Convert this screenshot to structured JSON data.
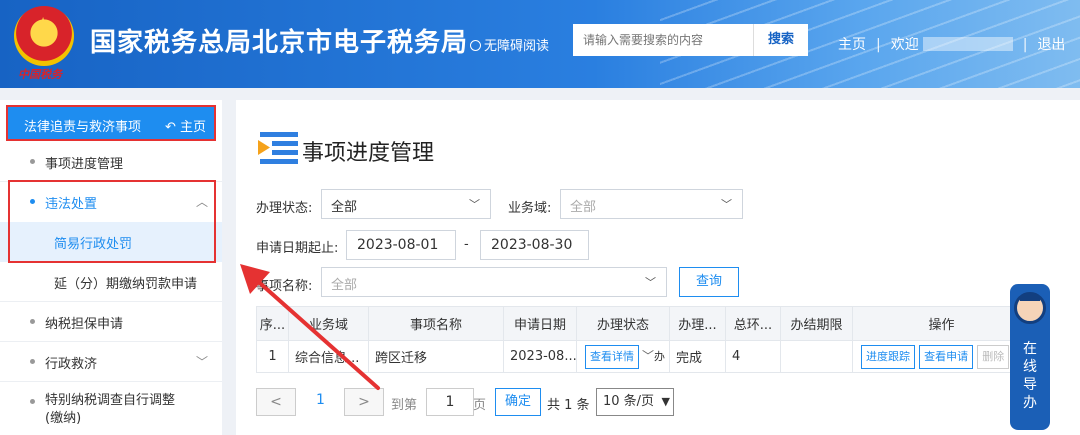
{
  "header": {
    "emblem_caption": "中国税务",
    "site_title": "国家税务总局北京市电子税务局",
    "accessibility": "无障碍阅读",
    "search_placeholder": "请输入需要搜索的内容",
    "search_button": "搜索",
    "nav_home": "主页",
    "nav_welcome": "欢迎",
    "nav_logout": "退出"
  },
  "sidebar": {
    "section_title": "法律追责与救济事项",
    "home_link": "主页",
    "items": [
      {
        "label": "事项进度管理"
      },
      {
        "label": "违法处置"
      },
      {
        "label": "简易行政处罚"
      },
      {
        "label": "延（分）期缴纳罚款申请"
      },
      {
        "label": "纳税担保申请"
      },
      {
        "label": "行政救济"
      },
      {
        "label": "特别纳税调查自行调整"
      },
      {
        "label": "(缴纳)"
      }
    ]
  },
  "main": {
    "title": "事项进度管理",
    "filters": {
      "status_label": "办理状态:",
      "status_value": "全部",
      "domain_label": "业务域:",
      "domain_placeholder": "全部",
      "date_label": "申请日期起止:",
      "date_from": "2023-08-01",
      "date_sep": "-",
      "date_to": "2023-08-30",
      "item_label": "事项名称:",
      "item_placeholder": "全部",
      "query_button": "查询"
    },
    "table": {
      "headers": [
        "序...",
        "业务域",
        "事项名称",
        "申请日期",
        "办理状态",
        "办理...",
        "总环...",
        "办结期限",
        "操作"
      ],
      "rows": [
        {
          "index": "1",
          "domain": "综合信息...",
          "name": "跨区迁移",
          "date": "2023-08...",
          "status_btn": "查看详情",
          "status_suffix": "办",
          "result": "完成",
          "total": "4",
          "deadline": "",
          "op_track": "进度跟踪",
          "op_view": "查看申请",
          "op_delete": "删除"
        }
      ]
    },
    "pagination": {
      "prev": "<",
      "current": "1",
      "next": ">",
      "goto_label": "到第",
      "goto_value": "1",
      "page_unit": "页",
      "confirm": "确定",
      "total": "共 1 条",
      "page_size": "10 条/页"
    }
  },
  "help_float": {
    "chars": [
      "在",
      "线",
      "导",
      "办"
    ]
  },
  "colors": {
    "header_blue": "#1763c4",
    "accent_blue": "#1e8df0",
    "annotation_red": "#e53232"
  }
}
